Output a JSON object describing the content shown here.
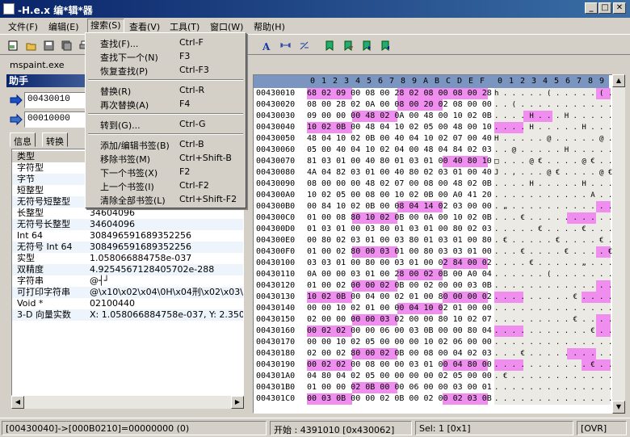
{
  "window": {
    "title": "-H.e.x 编*辑*器",
    "min": "_",
    "max": "□",
    "close": "✕"
  },
  "menu": {
    "file": "文件(F)",
    "edit": "编辑(E)",
    "search": "搜索(S)",
    "view": "查看(V)",
    "tools": "工具(T)",
    "window": "窗口(W)",
    "help": "帮助(H)"
  },
  "toolbar": {
    "icons": [
      "new-icon",
      "open-icon",
      "save-icon",
      "save-all-icon",
      "print-icon",
      "font-icon",
      "width-icon",
      "offset-icon",
      "bookmark-add-icon",
      "bookmark-remove-icon",
      "bookmark-next-icon",
      "bookmark-prev-icon"
    ]
  },
  "doc_tab": "mspaint.exe",
  "assistant": {
    "title": "助手",
    "addr1": "00430010",
    "addr2": "00010000",
    "tabs": [
      "信息",
      "转换"
    ],
    "header": "类型",
    "rows": [
      {
        "k": "字符型",
        "v": ""
      },
      {
        "k": "字节",
        "v": ""
      },
      {
        "k": "短整型",
        "v": ""
      },
      {
        "k": "无符号短整型",
        "v": ""
      },
      {
        "k": "长整型",
        "v": "34604096"
      },
      {
        "k": "无符号长整型",
        "v": "34604096"
      },
      {
        "k": "Int 64",
        "v": "308496591689352256"
      },
      {
        "k": "无符号 Int 64",
        "v": "308496591689352256"
      },
      {
        "k": "实型",
        "v": "1.058066884758e-037"
      },
      {
        "k": "双精度",
        "v": "4.9254567128405702e-288"
      },
      {
        "k": "字符串",
        "v": "@┤┘"
      },
      {
        "k": "可打印字符串",
        "v": "@\\x10\\x02\\x04\\0H\\x04刑\\x02\\x03\\"
      },
      {
        "k": "Void *",
        "v": "02100440"
      },
      {
        "k": "3-D 向量实数",
        "v": "X: 1.058066884758e-037, Y: 2.350989"
      }
    ]
  },
  "search_menu": [
    {
      "label": "查找(F)...",
      "shortcut": "Ctrl-F"
    },
    {
      "label": "查找下一个(N)",
      "shortcut": "F3"
    },
    {
      "label": "恢复查找(P)",
      "shortcut": "Ctrl-F3"
    },
    {
      "label": "替换(R)",
      "shortcut": "Ctrl-R"
    },
    {
      "label": "再次替换(A)",
      "shortcut": "F4"
    },
    {
      "label": "转到(G)...",
      "shortcut": "Ctrl-G"
    },
    {
      "label": "添加/编辑书签(B)",
      "shortcut": "Ctrl-B"
    },
    {
      "label": "移除书签(M)",
      "shortcut": "Ctrl+Shift-B"
    },
    {
      "label": "下一个书签(X)",
      "shortcut": "F2"
    },
    {
      "label": "上一个书签(I)",
      "shortcut": "Ctrl-F2"
    },
    {
      "label": "清除全部书签(L)",
      "shortcut": "Ctrl+Shift-F2"
    }
  ],
  "hex": {
    "header": [
      "0",
      "1",
      "2",
      "3",
      "4",
      "5",
      "6",
      "7",
      "8",
      "9",
      "A",
      "B",
      "C",
      "D",
      "E",
      "F",
      "0",
      "1",
      "2",
      "3",
      "4",
      "5",
      "6",
      "7",
      "8",
      "9"
    ],
    "rows": [
      {
        "addr": "00430010",
        "bytes": "68 02 09 00 08 00 28 02 08 00 08 00 28 02 09 00",
        "ascii": "h . . . . . ( . . . . . ( . . .",
        "hl": [
          [
            0,
            4
          ],
          [
            8,
            16
          ]
        ],
        "ahl": [
          [
            14,
            16
          ]
        ]
      },
      {
        "addr": "00430020",
        "bytes": "08 00 28 02 0A 00 08 00 20 02 08 00 00 02 00 02",
        "ascii": ". . ( . . . . . . . . . . . . .",
        "hl": [
          [
            8,
            12
          ]
        ],
        "ahl": []
      },
      {
        "addr": "00430030",
        "bytes": "09 00 00 00 48 02 0A 00 48 00 10 02 0B 00 48 00",
        "ascii": ". . . . H . . . H . . . . . H .",
        "hl": [
          [
            4,
            8
          ]
        ],
        "ahl": [
          [
            4,
            8
          ]
        ]
      },
      {
        "addr": "00430040",
        "bytes": "10 02 0B 00 48 04 10 02 05 00 48 00 10 02 05 00",
        "ascii": ". . . . H . . . . . H . . . . .",
        "hl": [
          [
            0,
            4
          ]
        ],
        "ahl": [
          [
            0,
            4
          ]
        ]
      },
      {
        "addr": "00430050",
        "bytes": "48 04 10 02 0B 00 40 04 10 02 07 00 40 04 10 02",
        "ascii": "H . . . . . @ . . . . . @ . . .",
        "hl": [],
        "ahl": []
      },
      {
        "addr": "00430060",
        "bytes": "05 00 40 04 10 02 04 00 48 04 84 02 03 00 40 00",
        "ascii": ". . @ . . . . . H . . . . . @ .",
        "hl": [],
        "ahl": []
      },
      {
        "addr": "00430070",
        "bytes": "81 03 01 00 40 80 01 03 01 00 40 80 10 02 0B 00",
        "ascii": "□ . . . @ € . . . . @ € . . . .",
        "hl": [
          [
            12,
            16
          ]
        ],
        "ahl": []
      },
      {
        "addr": "00430080",
        "bytes": "4A 04 82 03 01 00 40 80 02 03 01 00 40 80 28 02",
        "ascii": "J . ‚ . . . @ € . . . . @ € ( .",
        "hl": [],
        "ahl": []
      },
      {
        "addr": "00430090",
        "bytes": "08 00 00 00 48 02 07 00 08 00 48 02 0B 00 08 00",
        "ascii": ". . . . H . . . . . H . . . . .",
        "hl": [],
        "ahl": []
      },
      {
        "addr": "004300A0",
        "bytes": "10 02 05 00 08 00 10 02 0B 00 A0 41 20 30 10 00",
        "ascii": ". . . . . . . . . . . A . . . .",
        "hl": [],
        "ahl": []
      },
      {
        "addr": "004300B0",
        "bytes": "00 84 10 02 0B 00 08 04 14 02 03 00 00 00 12 03",
        "ascii": ". „ . . . . . . . . . . . . . .",
        "hl": [
          [
            8,
            12
          ]
        ],
        "ahl": [
          [
            14,
            16
          ]
        ]
      },
      {
        "addr": "004300C0",
        "bytes": "01 00 08 80 10 02 0B 00 0A 00 10 02 0B 00 00 00",
        "ascii": ". . . € . . . . . . . . . . . .",
        "hl": [
          [
            4,
            8
          ]
        ],
        "ahl": [
          [
            10,
            14
          ]
        ]
      },
      {
        "addr": "004300D0",
        "bytes": "01 03 01 00 03 80 01 03 01 00 80 02 03 01 00 80",
        "ascii": ". . . . . € . . . . € . . . . €",
        "hl": [],
        "ahl": []
      },
      {
        "addr": "004300E0",
        "bytes": "00 80 02 03 01 00 03 80 01 03 01 00 80 02 80 02",
        "ascii": ". € . . . . . € . . . . € . € .",
        "hl": [],
        "ahl": []
      },
      {
        "addr": "004300F0",
        "bytes": "01 00 02 80 00 03 01 00 80 03 03 01 00 80 03 03",
        "ascii": ". . . € . . . . € . . . . € . .",
        "hl": [
          [
            4,
            8
          ]
        ],
        "ahl": [
          [
            14,
            16
          ]
        ]
      },
      {
        "addr": "00430100",
        "bytes": "03 03 01 00 80 00 03 01 00 02 84 00 02 0B 00",
        "ascii": ". . . . € . . . . . „ . . . .",
        "hl": [
          [
            12,
            16
          ]
        ],
        "ahl": []
      },
      {
        "addr": "00430110",
        "bytes": "0A 00 00 03 01 00 28 00 02 0B 00 A0 04 00 02",
        "ascii": ". . . . . . ( . . . . . . . .",
        "hl": [
          [
            8,
            12
          ]
        ],
        "ahl": []
      },
      {
        "addr": "00430120",
        "bytes": "01 00 02 00 00 02 0B 00 02 00 00 03 0B 00 02 80",
        "ascii": ". . . . . . . . . . . . . . . €",
        "hl": [
          [
            4,
            8
          ]
        ],
        "ahl": [
          [
            14,
            16
          ]
        ]
      },
      {
        "addr": "00430130",
        "bytes": "10 02 0B 00 04 00 02 01 00 80 00 00 02 0B 00",
        "ascii": ". . . . . . . . . € . . . . .",
        "hl": [
          [
            0,
            4
          ],
          [
            12,
            16
          ]
        ],
        "ahl": [
          [
            0,
            4
          ],
          [
            12,
            16
          ]
        ]
      },
      {
        "addr": "00430140",
        "bytes": "00 00 10 02 01 00 00 04 10 02 01 00 00 00 10 02",
        "ascii": ". . . . . . . . . . . . . . . .",
        "hl": [
          [
            8,
            12
          ]
        ],
        "ahl": []
      },
      {
        "addr": "00430150",
        "bytes": "02 00 00 00 00 03 02 00 00 80 10 02 07 00 00 80",
        "ascii": ". . . . . . . . . € . . . . . €",
        "hl": [
          [
            4,
            8
          ]
        ],
        "ahl": [
          [
            14,
            16
          ]
        ]
      },
      {
        "addr": "00430160",
        "bytes": "00 02 02 00 00 06 00 03 0B 00 00 80 04 02 06 00",
        "ascii": ". . . . . . . . . . . € . . . .",
        "hl": [
          [
            0,
            4
          ]
        ],
        "ahl": [
          [
            0,
            4
          ],
          [
            14,
            16
          ]
        ]
      },
      {
        "addr": "00430170",
        "bytes": "00 00 10 02 05 00 00 00 10 02 06 00 00 00 00 00",
        "ascii": ". . . . . . . . . . . . . . . .",
        "hl": [],
        "ahl": []
      },
      {
        "addr": "00430180",
        "bytes": "02 00 02 80 00 02 0B 00 08 00 04 02 03 00 00 00",
        "ascii": ". . . € . . . . . . . . . . . .",
        "hl": [
          [
            4,
            8
          ]
        ],
        "ahl": [
          [
            10,
            14
          ]
        ]
      },
      {
        "addr": "00430190",
        "bytes": "00 02 02 00 08 00 00 03 01 00 04 80 00 02 0B 00",
        "ascii": ". . . . . . . . . . . € . . . .",
        "hl": [
          [
            0,
            4
          ],
          [
            12,
            16
          ]
        ],
        "ahl": [
          [
            0,
            4
          ],
          [
            12,
            16
          ]
        ]
      },
      {
        "addr": "004301A0",
        "bytes": "04 80 04 02 05 00 00 00 00 02 05 00 00 03 08 02",
        "ascii": ". € . . . . . . . . . . . . . .",
        "hl": [],
        "ahl": []
      },
      {
        "addr": "004301B0",
        "bytes": "01 00 00 02 0B 00 00 06 00 00 03 00 01 00 00 00",
        "ascii": ". . . . . . . . . . . . . . . .",
        "hl": [
          [
            4,
            8
          ]
        ],
        "ahl": []
      },
      {
        "addr": "004301C0",
        "bytes": "00 03 0B 00 00 02 0B 00 02 00 02 03 0B 00",
        "ascii": ". . . . . . . . . . . . . .",
        "hl": [
          [
            0,
            4
          ],
          [
            12,
            16
          ]
        ],
        "ahl": []
      }
    ]
  },
  "status": {
    "left": "[00430040]->[000B0210]=00000000 (0)",
    "start": "开始 : 4391010 [0x430062]",
    "sel": "Sel: 1 [0x1]",
    "mode": "[OVR]"
  }
}
